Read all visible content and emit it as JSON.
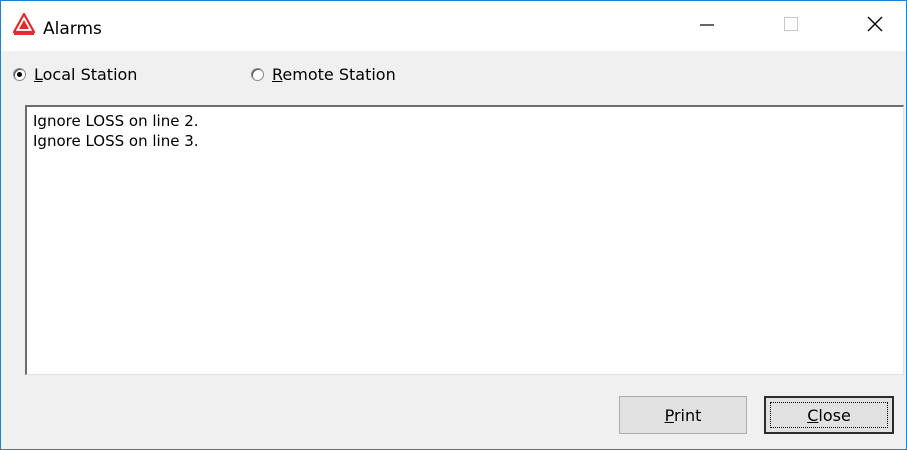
{
  "window": {
    "title": "Alarms",
    "app_icon": "warning-triangle-icon",
    "border_color": "#1883d7"
  },
  "titlebar_buttons": {
    "minimize_icon": "minimize-icon",
    "maximize_icon": "maximize-icon",
    "close_icon": "close-icon"
  },
  "station_options": {
    "local": {
      "mnemonic": "L",
      "rest": "ocal Station",
      "checked": true
    },
    "remote": {
      "mnemonic": "R",
      "rest": "emote Station",
      "checked": false
    }
  },
  "alarm_list": {
    "lines": [
      "Ignore LOSS on line 2.",
      "Ignore LOSS on line 3."
    ]
  },
  "buttons": {
    "print": {
      "mnemonic": "P",
      "rest": "rint"
    },
    "close": {
      "mnemonic": "C",
      "rest": "lose"
    }
  },
  "colors": {
    "accent": "#1883d7",
    "icon_red": "#e32b2b"
  }
}
